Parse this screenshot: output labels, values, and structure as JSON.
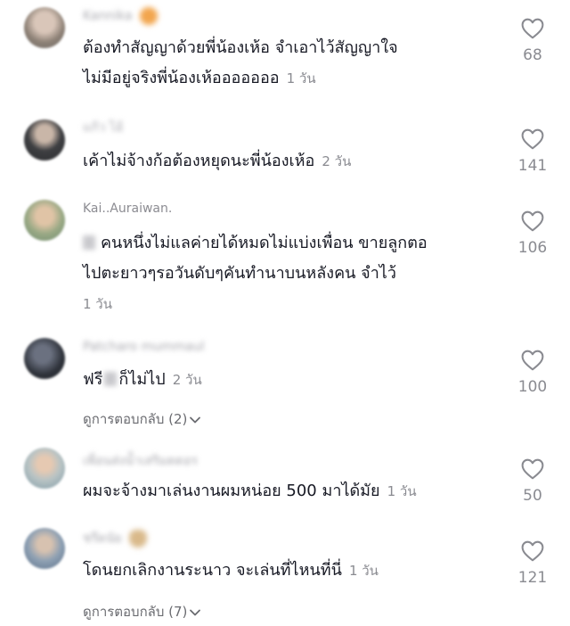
{
  "comments": [
    {
      "username": "Kannika",
      "text_lines": [
        "ต้องทำสัญญาด้วยพี่น้องเห้อ จำเอาไว้สัญญาใจ",
        "ไม่มีอยู่จริงพี่น้องเห้อออออออ"
      ],
      "time": "1 วัน",
      "likes": "68",
      "avatar_color": "#a2978f",
      "emoji": "smile-emoji"
    },
    {
      "username": "แก้ว ไอ้",
      "text_lines": [
        "เค้าไม่จ้างก้อต้องหยุดนะพี่น้องเห้อ"
      ],
      "time": "2 วัน",
      "likes": "141",
      "avatar_color": "#3d4145"
    },
    {
      "username": "Kai..Auraiwan.",
      "text_lines": [
        "คนหนึ่งไม่แลค่ายได้หมดไม่แบ่งเพื่อน ขายลูกตอ",
        "ไปตะยาวๆรอวันดับๆคันทำนาบนหลังคน จำไว้"
      ],
      "time": "1 วัน",
      "likes": "106",
      "avatar_color": "#9bab8a"
    },
    {
      "username": "Patcharo mummaul",
      "text_lines": [
        "ฟรี",
        "ก็ไม่ไป"
      ],
      "time": "2 วัน",
      "likes": "100",
      "replies": "ดูการตอบกลับ (2)",
      "avatar_color": "#3b3f48"
    },
    {
      "username": "เพื่อนส่งน้ำเสริมดดอร",
      "text_lines": [
        "ผมจะจ้างมาเล่นงานผมหน่อย 500 มาได้มัย"
      ],
      "time": "1 วัน",
      "likes": "50",
      "avatar_color": "#a4b2b4"
    },
    {
      "username": "ชรีดนัย",
      "text_lines": [
        "โดนยกเลิกงานระนาว จะเล่นที่ไหนที่นี่"
      ],
      "time": "1 วัน",
      "likes": "121",
      "replies": "ดูการตอบกลับ (7)",
      "avatar_color": "#8fa2b6",
      "emoji": "bear-emoji"
    }
  ]
}
